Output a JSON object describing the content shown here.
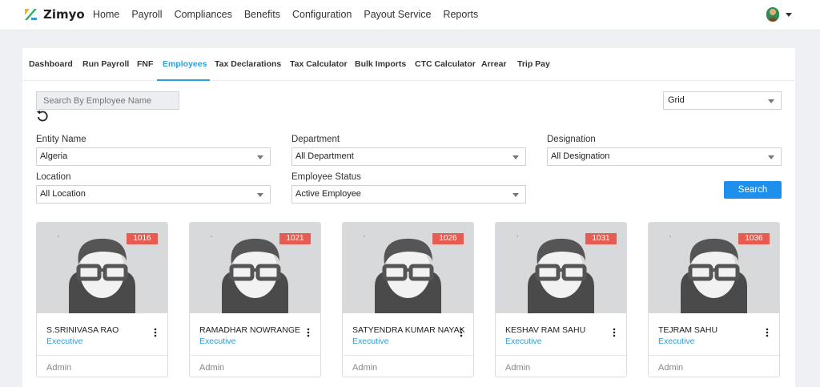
{
  "app": {
    "brand": "Zimyo"
  },
  "topnav": [
    "Home",
    "Payroll",
    "Compliances",
    "Benefits",
    "Configuration",
    "Payout Service",
    "Reports"
  ],
  "subnav": {
    "tabs": [
      "Dashboard",
      "Run Payroll",
      "FNF",
      "Employees",
      "Tax Declarations",
      "Tax Calculator",
      "Bulk Imports",
      "CTC Calculator",
      "Arrear",
      "Trip Pay"
    ],
    "active": "Employees"
  },
  "search": {
    "placeholder": "Search By Employee Name"
  },
  "view_mode": {
    "selected": "Grid"
  },
  "filters": {
    "entity": {
      "label": "Entity Name",
      "value": "Algeria"
    },
    "department": {
      "label": "Department",
      "value": "All Department"
    },
    "designation": {
      "label": "Designation",
      "value": "All Designation"
    },
    "location": {
      "label": "Location",
      "value": "All Location"
    },
    "status": {
      "label": "Employee Status",
      "value": "Active Employee"
    }
  },
  "search_button": "Search",
  "employees": [
    {
      "id": "1016",
      "name": "S.SRINIVASA RAO",
      "role": "Executive",
      "department": "Admin"
    },
    {
      "id": "1021",
      "name": "RAMADHAR NOWRANGE",
      "role": "Executive",
      "department": "Admin"
    },
    {
      "id": "1026",
      "name": "SATYENDRA KUMAR NAYAK",
      "role": "Executive",
      "department": "Admin"
    },
    {
      "id": "1031",
      "name": "KESHAV RAM SAHU",
      "role": "Executive",
      "department": "Admin"
    },
    {
      "id": "1036",
      "name": "TEJRAM SAHU",
      "role": "Executive",
      "department": "Admin"
    }
  ],
  "colors": {
    "accent": "#2a9fd8",
    "button": "#1e90ec",
    "badge": "#e65c50"
  },
  "icons": {
    "reset": "refresh-icon",
    "more": "kebab-menu-icon",
    "dropdown": "chevron-down-icon",
    "placeholder_photo": "user-placeholder-icon"
  }
}
